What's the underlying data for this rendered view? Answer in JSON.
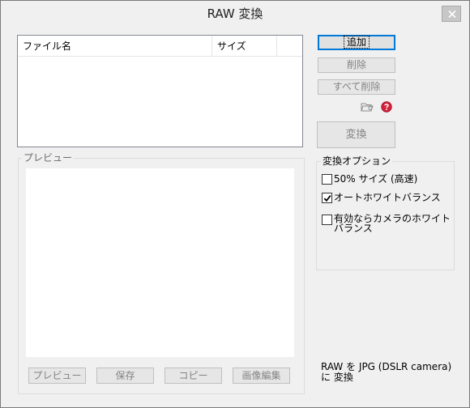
{
  "window": {
    "title": "RAW 変換"
  },
  "file_list": {
    "columns": [
      "ファイル名",
      "サイズ"
    ]
  },
  "buttons": {
    "add": "追加",
    "delete": "削除",
    "delete_all": "すべて削除",
    "convert": "変換"
  },
  "preview_group": {
    "label": "プレビュー",
    "buttons": {
      "preview": "プレビュー",
      "save": "保存",
      "copy": "コピー",
      "edit": "画像編集"
    }
  },
  "options_group": {
    "label": "変換オプション",
    "options": [
      {
        "label": "50% サイズ (高速)",
        "checked": false
      },
      {
        "label": "オートホワイトバランス",
        "checked": true
      },
      {
        "label": "有効ならカメラのホワイトバランス",
        "checked": false
      }
    ]
  },
  "info": {
    "text": "RAW を JPG (DSLR camera)に 変換"
  },
  "colors": {
    "help_icon": "#d3203a",
    "default_button_border": "#0078d7"
  }
}
